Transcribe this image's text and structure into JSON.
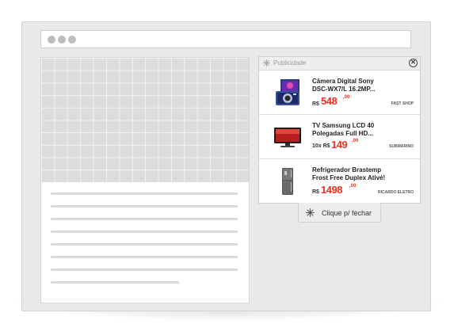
{
  "ad": {
    "header_label": "Publicidade",
    "close_symbol": "✕",
    "products": [
      {
        "name_line1": "Câmera Digital Sony",
        "name_line2": "DSC-WX7/L 16.2MP...",
        "price_prefix": "R$",
        "price": "548",
        "cents": ",00",
        "store": "FAST SHOP"
      },
      {
        "name_line1": "TV Samsung LCD 40",
        "name_line2": "Polegadas Full HD...",
        "price_prefix": "10x R$",
        "price": "149",
        "cents": ",00",
        "store": "SUBMARINO"
      },
      {
        "name_line1": "Refrigerador Brastemp",
        "name_line2": "Frost Free Duplex Ativé!",
        "price_prefix": "R$",
        "price": "1498",
        "cents": ",00",
        "store": "RICARDO ELETRO"
      }
    ],
    "close_tab_label": "Clique p/ fechar"
  },
  "colors": {
    "price": "#ee3124",
    "frame": "#e9e9e9"
  }
}
